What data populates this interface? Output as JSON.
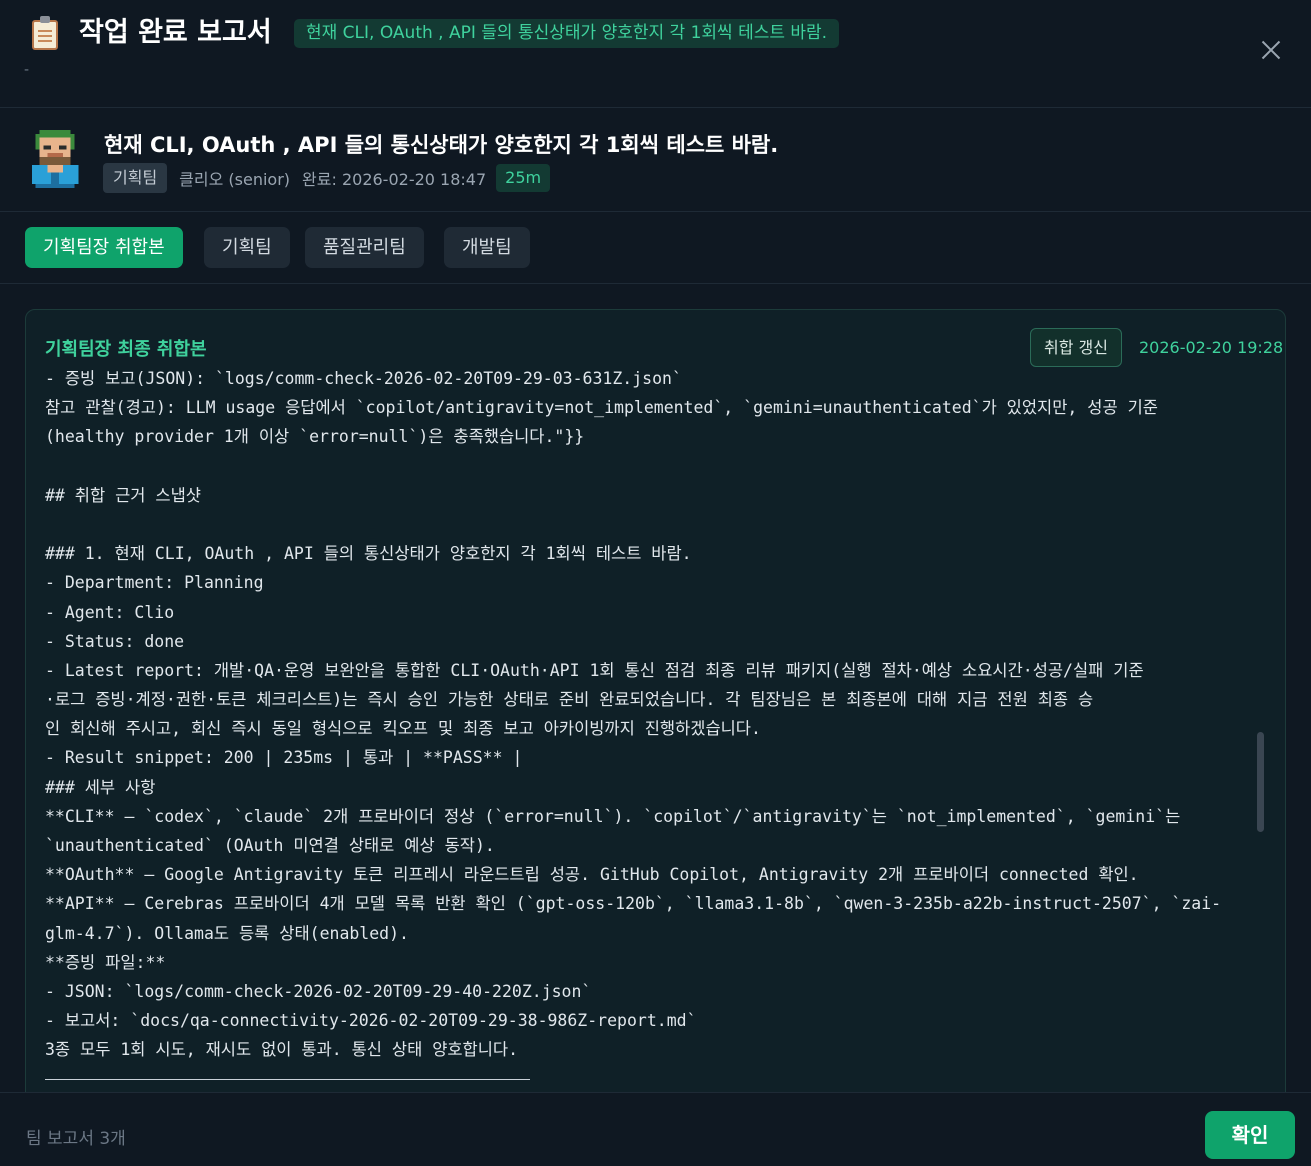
{
  "header": {
    "title": "작업 완료 보고서",
    "badge": "현재 CLI, OAuth , API 들의 통신상태가 양호한지 각 1회씩 테스트 바람.",
    "subtitle": "-",
    "icon": "clipboard-icon",
    "close_icon": "close-icon"
  },
  "task": {
    "title": "현재 CLI, OAuth , API 들의 통신상태가 양호한지 각 1회씩 테스트 바람.",
    "team": "기획팀",
    "agent": "클리오 (senior)",
    "completed": "완료: 2026-02-20 18:47",
    "duration": "25m"
  },
  "tabs": [
    {
      "label": "기획팀장 취합본",
      "active": true
    },
    {
      "label": "기획팀",
      "active": false
    },
    {
      "label": "품질관리팀",
      "active": false
    },
    {
      "label": "개발팀",
      "active": false
    }
  ],
  "panel": {
    "title": "기획팀장 최종 취합본",
    "refresh_label": "취합 갱신",
    "timestamp": "2026-02-20 19:28",
    "lines": [
      "- 증빙 보고(JSON): `logs/comm-check-2026-02-20T09-29-03-631Z.json`",
      "참고 관찰(경고): LLM usage 응답에서 `copilot/antigravity=not_implemented`, `gemini=unauthenticated`가 있었지만, 성공 기준",
      "(healthy provider 1개 이상 `error=null`)은 충족했습니다.\"}}",
      "",
      "## 취합 근거 스냅샷",
      "",
      "### 1. 현재 CLI, OAuth , API 들의 통신상태가 양호한지 각 1회씩 테스트 바람.",
      "- Department: Planning",
      "- Agent: Clio",
      "- Status: done",
      "- Latest report: 개발·QA·운영 보완안을 통합한 CLI·OAuth·API 1회 통신 점검 최종 리뷰 패키지(실행 절차·예상 소요시간·성공/실패 기준",
      "·로그 증빙·계정·권한·토큰 체크리스트)는 즉시 승인 가능한 상태로 준비 완료되었습니다. 각 팀장님은 본 최종본에 대해 지금 전원 최종 승",
      "인 회신해 주시고, 회신 즉시 동일 형식으로 킥오프 및 최종 보고 아카이빙까지 진행하겠습니다.",
      "- Result snippet: 200 | 235ms | 통과 | **PASS** |",
      "### 세부 사항",
      "**CLI** — `codex`, `claude` 2개 프로바이더 정상 (`error=null`). `copilot`/`antigravity`는 `not_implemented`, `gemini`는",
      "`unauthenticated` (OAuth 미연결 상태로 예상 동작).",
      "**OAuth** — Google Antigravity 토큰 리프레시 라운드트립 성공. GitHub Copilot, Antigravity 2개 프로바이더 connected 확인.",
      "**API** — Cerebras 프로바이더 4개 모델 목록 반환 확인 (`gpt-oss-120b`, `llama3.1-8b`, `qwen-3-235b-a22b-instruct-2507`, `zai-",
      "glm-4.7`). Ollama도 등록 상태(enabled).",
      "**증빙 파일:**",
      "- JSON: `logs/comm-check-2026-02-20T09-29-40-220Z.json`",
      "- 보고서: `docs/qa-connectivity-2026-02-20T09-29-38-986Z-report.md`",
      "3종 모두 1회 시도, 재시도 없이 통과. 통신 상태 양호합니다."
    ]
  },
  "footer": {
    "count_text": "팀 보고서 3개",
    "confirm_label": "확인"
  }
}
